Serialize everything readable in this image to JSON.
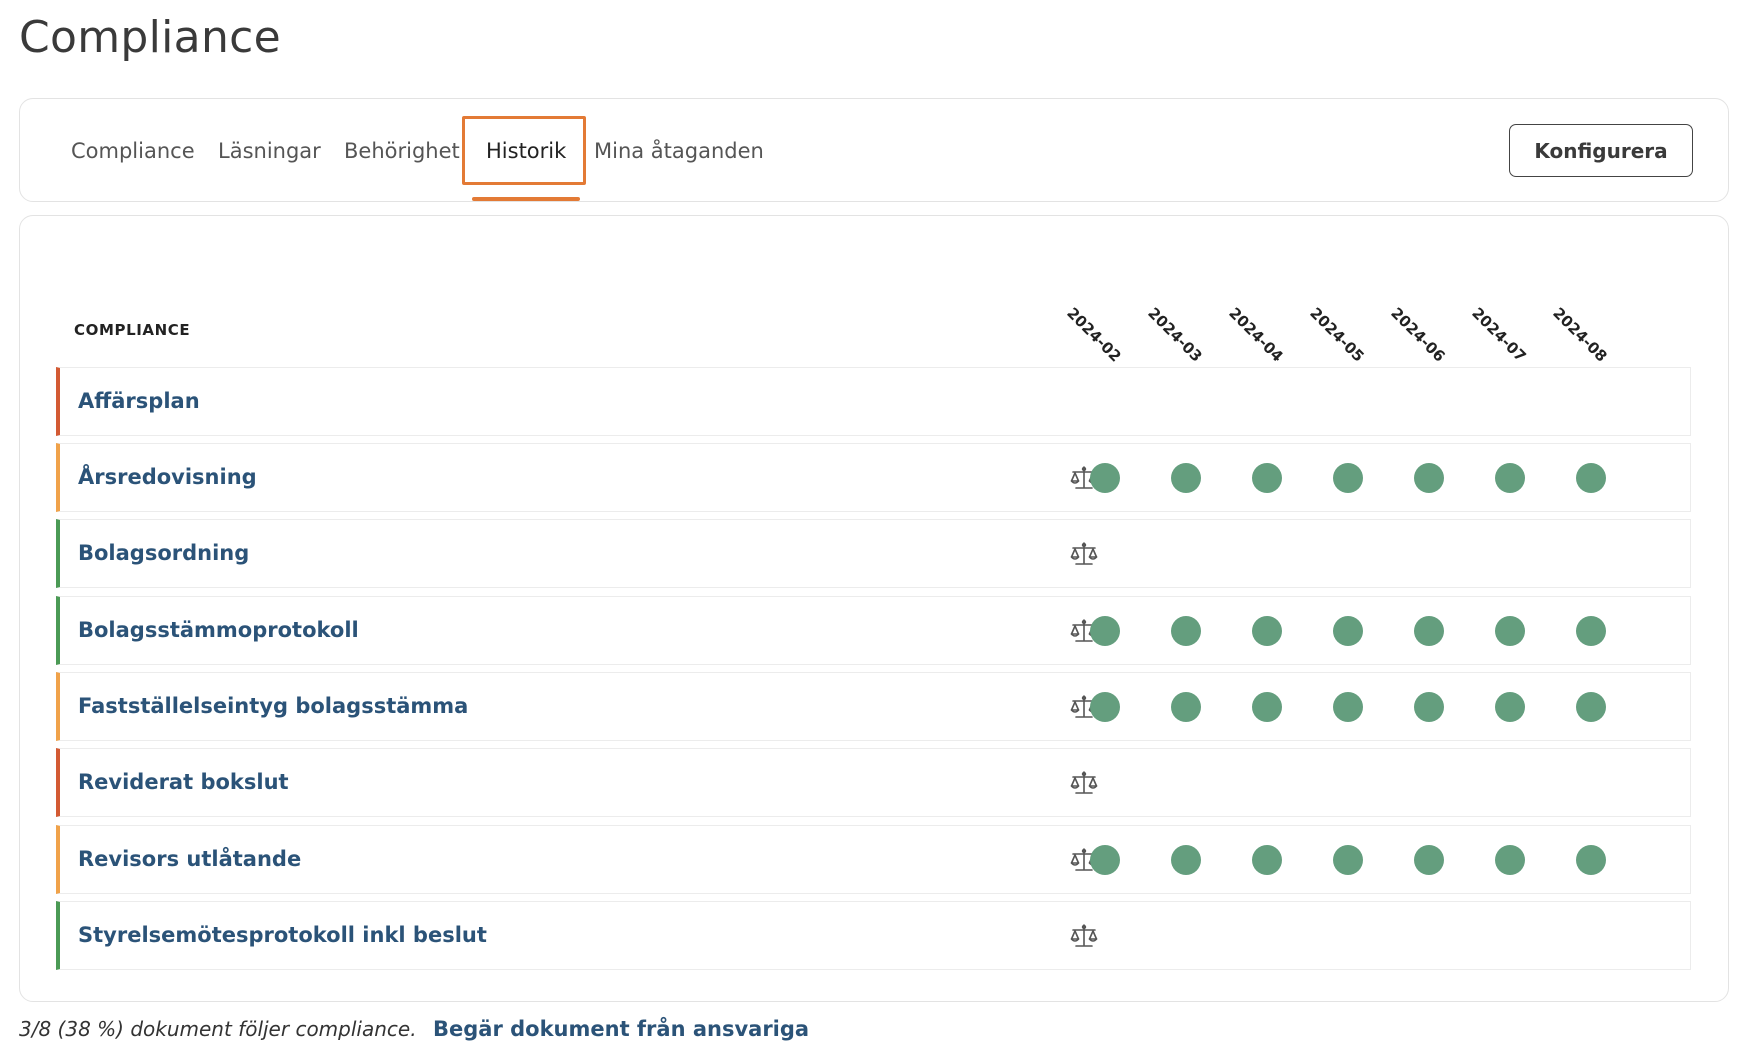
{
  "page_title": "Compliance",
  "tabs": [
    {
      "label": "Compliance",
      "active": false
    },
    {
      "label": "Läsningar",
      "active": false
    },
    {
      "label": "Behörighet",
      "active": false
    },
    {
      "label": "Historik",
      "active": true
    },
    {
      "label": "Mina åtaganden",
      "active": false
    }
  ],
  "configure_button": "Konfigurera",
  "table": {
    "header": "COMPLIANCE",
    "months": [
      "2024-02",
      "2024-03",
      "2024-04",
      "2024-05",
      "2024-06",
      "2024-07",
      "2024-08"
    ],
    "rows": [
      {
        "name": "Affärsplan",
        "status": "red",
        "has_scale": false,
        "history": [
          false,
          false,
          false,
          false,
          false,
          false,
          false
        ]
      },
      {
        "name": "Årsredovisning",
        "status": "orange",
        "has_scale": true,
        "history": [
          true,
          true,
          true,
          true,
          true,
          true,
          true
        ]
      },
      {
        "name": "Bolagsordning",
        "status": "green",
        "has_scale": true,
        "history": [
          false,
          false,
          false,
          false,
          false,
          false,
          false
        ]
      },
      {
        "name": "Bolagsstämmoprotokoll",
        "status": "green",
        "has_scale": true,
        "history": [
          true,
          true,
          true,
          true,
          true,
          true,
          true
        ]
      },
      {
        "name": "Fastställelseintyg bolagsstämma",
        "status": "orange",
        "has_scale": true,
        "history": [
          true,
          true,
          true,
          true,
          true,
          true,
          true
        ]
      },
      {
        "name": "Reviderat bokslut",
        "status": "red",
        "has_scale": true,
        "history": [
          false,
          false,
          false,
          false,
          false,
          false,
          false
        ]
      },
      {
        "name": "Revisors utlåtande",
        "status": "orange",
        "has_scale": true,
        "history": [
          true,
          true,
          true,
          true,
          true,
          true,
          true
        ]
      },
      {
        "name": "Styrelsemötesprotokoll inkl beslut",
        "status": "green",
        "has_scale": true,
        "history": [
          false,
          false,
          false,
          false,
          false,
          false,
          false
        ]
      }
    ]
  },
  "footer": {
    "summary": "3/8 (38 %) dokument följer compliance.",
    "link": "Begär dokument från ansvariga"
  },
  "colors": {
    "accent": "#e37a35",
    "link": "#2b5378",
    "compliant_dot": "#649e7e",
    "status_red": "#d35a33",
    "status_orange": "#f0a24a",
    "status_green": "#4b9a55"
  }
}
